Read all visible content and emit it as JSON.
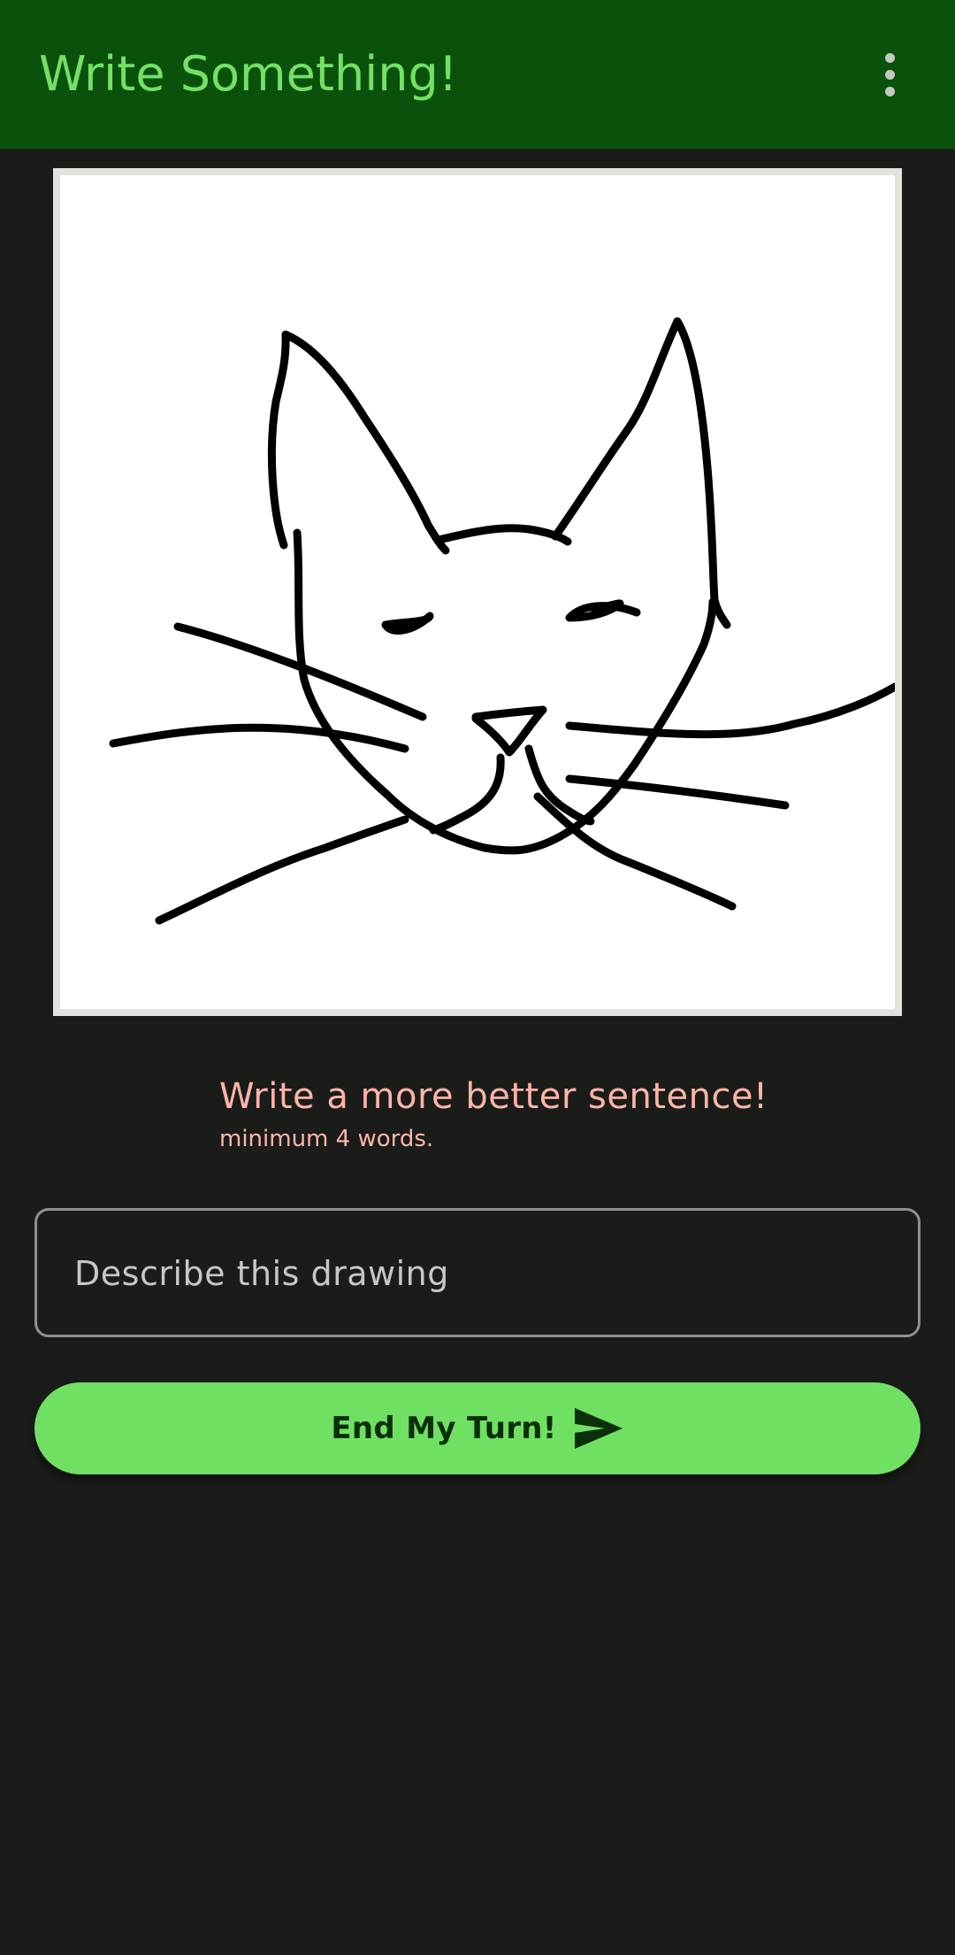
{
  "app_bar": {
    "title": "Write Something!",
    "menu_icon": "more-vert-icon",
    "background": "#0a520c",
    "title_color": "#74e066"
  },
  "drawing": {
    "subject_icon": "cat-drawing"
  },
  "hint": {
    "title": "Write a more better sentence!",
    "subtitle": "minimum 4 words.",
    "color": "#ffb4a9"
  },
  "description_input": {
    "placeholder": "Describe this drawing",
    "value": ""
  },
  "end_turn_button": {
    "label": "End My Turn!",
    "icon": "send-icon",
    "background": "#70e063"
  }
}
